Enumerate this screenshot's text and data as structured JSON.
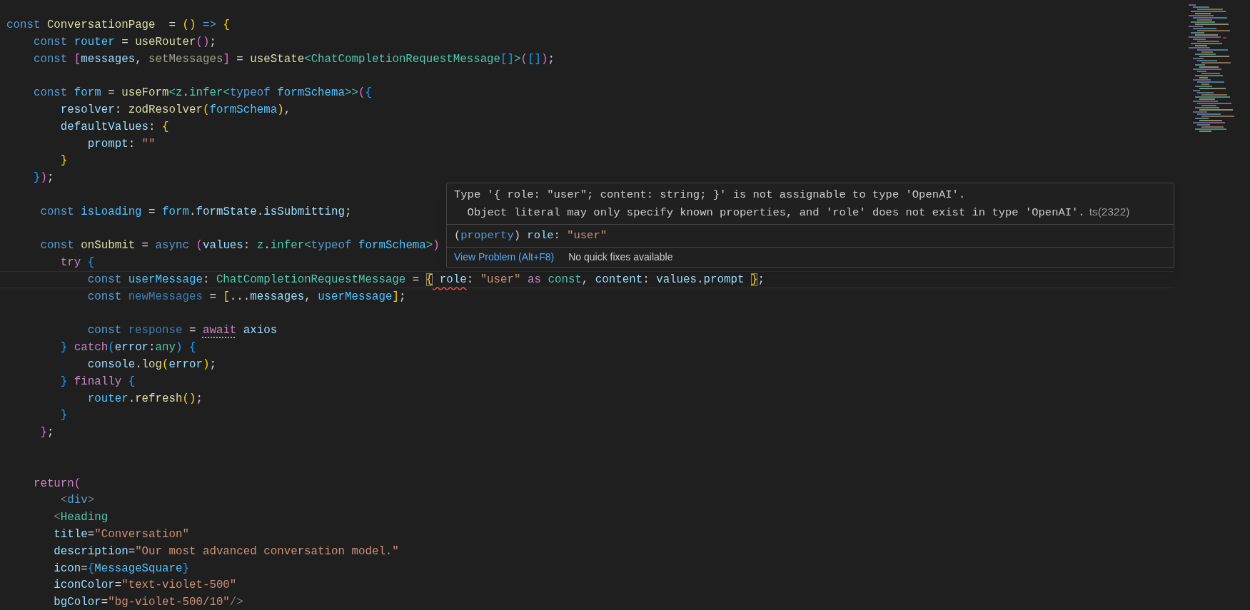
{
  "editor": {
    "lines": [
      {
        "kind": "code",
        "tokens": [
          {
            "text": "const ",
            "kind": "kw"
          },
          {
            "text": "ConversationPage",
            "kind": "fn"
          },
          {
            "text": "  = ",
            "kind": "p"
          },
          {
            "text": "() ",
            "kind": "b1"
          },
          {
            "text": "=> ",
            "kind": "kw"
          },
          {
            "text": "{",
            "kind": "b1"
          }
        ]
      },
      {
        "kind": "code",
        "tokens": [
          {
            "text": "    const ",
            "kind": "kw"
          },
          {
            "text": "router",
            "kind": "cvar"
          },
          {
            "text": " = ",
            "kind": "p"
          },
          {
            "text": "useRouter",
            "kind": "fn"
          },
          {
            "text": "()",
            "kind": "b2"
          },
          {
            "text": ";",
            "kind": "p"
          }
        ]
      },
      {
        "kind": "code",
        "tokens": [
          {
            "text": "    const ",
            "kind": "kw"
          },
          {
            "text": "[",
            "kind": "b2"
          },
          {
            "text": "messages",
            "kind": "var"
          },
          {
            "text": ", ",
            "kind": "p"
          },
          {
            "text": "setMessages",
            "kind": "unused_fn"
          },
          {
            "text": "]",
            "kind": "b2"
          },
          {
            "text": " = ",
            "kind": "p"
          },
          {
            "text": "useState",
            "kind": "fn"
          },
          {
            "text": "<",
            "kind": "type"
          },
          {
            "text": "ChatCompletionRequestMessage",
            "kind": "type"
          },
          {
            "text": "[]",
            "kind": "b3"
          },
          {
            "text": ">",
            "kind": "type"
          },
          {
            "text": "(",
            "kind": "b2"
          },
          {
            "text": "[]",
            "kind": "b3"
          },
          {
            "text": ")",
            "kind": "b2"
          },
          {
            "text": ";",
            "kind": "p"
          }
        ]
      },
      {
        "kind": "blank"
      },
      {
        "kind": "code",
        "tokens": [
          {
            "text": "    const ",
            "kind": "kw"
          },
          {
            "text": "form",
            "kind": "cvar"
          },
          {
            "text": " = ",
            "kind": "p"
          },
          {
            "text": "useForm",
            "kind": "fn"
          },
          {
            "text": "<",
            "kind": "type"
          },
          {
            "text": "z",
            "kind": "type"
          },
          {
            "text": ".",
            "kind": "p"
          },
          {
            "text": "infer",
            "kind": "type"
          },
          {
            "text": "<",
            "kind": "type"
          },
          {
            "text": "typeof ",
            "kind": "kw"
          },
          {
            "text": "formSchema",
            "kind": "cvar"
          },
          {
            "text": ">>",
            "kind": "type"
          },
          {
            "text": "(",
            "kind": "b2"
          },
          {
            "text": "{",
            "kind": "b3"
          }
        ]
      },
      {
        "kind": "code",
        "tokens": [
          {
            "text": "        resolver",
            "kind": "var"
          },
          {
            "text": ": ",
            "kind": "p"
          },
          {
            "text": "zodResolver",
            "kind": "fn"
          },
          {
            "text": "(",
            "kind": "b1"
          },
          {
            "text": "formSchema",
            "kind": "cvar"
          },
          {
            "text": ")",
            "kind": "b1"
          },
          {
            "text": ",",
            "kind": "p"
          }
        ]
      },
      {
        "kind": "code",
        "tokens": [
          {
            "text": "        defaultValues",
            "kind": "var"
          },
          {
            "text": ": ",
            "kind": "p"
          },
          {
            "text": "{",
            "kind": "b1"
          }
        ]
      },
      {
        "kind": "code",
        "tokens": [
          {
            "text": "            prompt",
            "kind": "var"
          },
          {
            "text": ": ",
            "kind": "p"
          },
          {
            "text": "\"\"",
            "kind": "str"
          }
        ]
      },
      {
        "kind": "code",
        "tokens": [
          {
            "text": "        }",
            "kind": "b1"
          }
        ]
      },
      {
        "kind": "code",
        "tokens": [
          {
            "text": "    }",
            "kind": "b3"
          },
          {
            "text": ")",
            "kind": "b2"
          },
          {
            "text": ";",
            "kind": "p"
          }
        ]
      },
      {
        "kind": "blank"
      },
      {
        "kind": "code",
        "tokens": [
          {
            "text": "     const ",
            "kind": "kw"
          },
          {
            "text": "isLoading",
            "kind": "cvar"
          },
          {
            "text": " = ",
            "kind": "p"
          },
          {
            "text": "form",
            "kind": "cvar"
          },
          {
            "text": ".",
            "kind": "p"
          },
          {
            "text": "formState",
            "kind": "var"
          },
          {
            "text": ".",
            "kind": "p"
          },
          {
            "text": "isSubmitting",
            "kind": "var"
          },
          {
            "text": ";",
            "kind": "p"
          }
        ]
      },
      {
        "kind": "blank"
      },
      {
        "kind": "code",
        "tokens": [
          {
            "text": "     const ",
            "kind": "kw"
          },
          {
            "text": "onSubmit",
            "kind": "fn"
          },
          {
            "text": " = ",
            "kind": "p"
          },
          {
            "text": "async ",
            "kind": "kw"
          },
          {
            "text": "(",
            "kind": "b2"
          },
          {
            "text": "values",
            "kind": "var"
          },
          {
            "text": ": ",
            "kind": "p"
          },
          {
            "text": "z",
            "kind": "type"
          },
          {
            "text": ".",
            "kind": "p"
          },
          {
            "text": "infer",
            "kind": "type"
          },
          {
            "text": "<",
            "kind": "type"
          },
          {
            "text": "typeof ",
            "kind": "kw"
          },
          {
            "text": "formSchema",
            "kind": "cvar"
          },
          {
            "text": ">",
            "kind": "type"
          },
          {
            "text": ")",
            "kind": "b2"
          }
        ]
      },
      {
        "kind": "code",
        "tokens": [
          {
            "text": "        try ",
            "kind": "ctrl"
          },
          {
            "text": "{",
            "kind": "b3"
          }
        ]
      },
      {
        "kind": "code",
        "current": true,
        "tokens": [
          {
            "text": "            const ",
            "kind": "kw"
          },
          {
            "text": "userMessage",
            "kind": "cvar"
          },
          {
            "text": ": ",
            "kind": "p"
          },
          {
            "text": "ChatCompletionRequestMessage",
            "kind": "type"
          },
          {
            "text": " = ",
            "kind": "p"
          },
          {
            "text": "{",
            "kind": "b1",
            "matched": true
          },
          {
            "text": " role",
            "kind": "var",
            "error": true
          },
          {
            "text": ": ",
            "kind": "p"
          },
          {
            "text": "\"user\"",
            "kind": "str"
          },
          {
            "text": " as ",
            "kind": "ctrl"
          },
          {
            "text": "const",
            "kind": "type"
          },
          {
            "text": ", ",
            "kind": "p"
          },
          {
            "text": "content",
            "kind": "var"
          },
          {
            "text": ": ",
            "kind": "p"
          },
          {
            "text": "values",
            "kind": "var"
          },
          {
            "text": ".",
            "kind": "p"
          },
          {
            "text": "prompt ",
            "kind": "var"
          },
          {
            "text": "}",
            "kind": "b1",
            "matched": true
          },
          {
            "text": ";",
            "kind": "p"
          }
        ]
      },
      {
        "kind": "code",
        "tokens": [
          {
            "text": "            const ",
            "kind": "kw"
          },
          {
            "text": "newMessages",
            "kind": "unused_var"
          },
          {
            "text": " = ",
            "kind": "p"
          },
          {
            "text": "[",
            "kind": "b1"
          },
          {
            "text": "...",
            "kind": "p"
          },
          {
            "text": "messages",
            "kind": "var"
          },
          {
            "text": ", ",
            "kind": "p"
          },
          {
            "text": "userMessage",
            "kind": "cvar"
          },
          {
            "text": "]",
            "kind": "b1"
          },
          {
            "text": ";",
            "kind": "p"
          }
        ]
      },
      {
        "kind": "blank"
      },
      {
        "kind": "code",
        "tokens": [
          {
            "text": "            const ",
            "kind": "kw"
          },
          {
            "text": "response",
            "kind": "unused_var"
          },
          {
            "text": " = ",
            "kind": "p"
          },
          {
            "text": "await",
            "kind": "ctrl",
            "hint": true
          },
          {
            "text": " axios",
            "kind": "var"
          }
        ]
      },
      {
        "kind": "code",
        "tokens": [
          {
            "text": "        } ",
            "kind": "b3"
          },
          {
            "text": "catch",
            "kind": "ctrl"
          },
          {
            "text": "(",
            "kind": "b3"
          },
          {
            "text": "error",
            "kind": "var"
          },
          {
            "text": ":",
            "kind": "p"
          },
          {
            "text": "any",
            "kind": "type"
          },
          {
            "text": ") ",
            "kind": "b3"
          },
          {
            "text": "{",
            "kind": "b3"
          }
        ]
      },
      {
        "kind": "code",
        "tokens": [
          {
            "text": "            console",
            "kind": "var"
          },
          {
            "text": ".",
            "kind": "p"
          },
          {
            "text": "log",
            "kind": "fn"
          },
          {
            "text": "(",
            "kind": "b1"
          },
          {
            "text": "error",
            "kind": "var"
          },
          {
            "text": ")",
            "kind": "b1"
          },
          {
            "text": ";",
            "kind": "p"
          }
        ]
      },
      {
        "kind": "code",
        "tokens": [
          {
            "text": "        } ",
            "kind": "b3"
          },
          {
            "text": "finally ",
            "kind": "ctrl"
          },
          {
            "text": "{",
            "kind": "b3"
          }
        ]
      },
      {
        "kind": "code",
        "tokens": [
          {
            "text": "            router",
            "kind": "cvar"
          },
          {
            "text": ".",
            "kind": "p"
          },
          {
            "text": "refresh",
            "kind": "fn"
          },
          {
            "text": "()",
            "kind": "b1"
          },
          {
            "text": ";",
            "kind": "p"
          }
        ]
      },
      {
        "kind": "code",
        "tokens": [
          {
            "text": "        }",
            "kind": "b3"
          }
        ]
      },
      {
        "kind": "code",
        "tokens": [
          {
            "text": "     }",
            "kind": "b2"
          },
          {
            "text": ";",
            "kind": "p"
          }
        ]
      },
      {
        "kind": "blank"
      },
      {
        "kind": "blank"
      },
      {
        "kind": "code",
        "tokens": [
          {
            "text": "    return",
            "kind": "ctrl"
          },
          {
            "text": "(",
            "kind": "b2"
          }
        ]
      },
      {
        "kind": "code",
        "tokens": [
          {
            "text": "        <",
            "kind": "tag"
          },
          {
            "text": "div",
            "kind": "kw"
          },
          {
            "text": ">",
            "kind": "tag"
          }
        ]
      },
      {
        "kind": "code",
        "tokens": [
          {
            "text": "       <",
            "kind": "tag"
          },
          {
            "text": "Heading",
            "kind": "type"
          }
        ]
      },
      {
        "kind": "code",
        "tokens": [
          {
            "text": "       title",
            "kind": "var"
          },
          {
            "text": "=",
            "kind": "p"
          },
          {
            "text": "\"Conversation\"",
            "kind": "str"
          }
        ]
      },
      {
        "kind": "code",
        "tokens": [
          {
            "text": "       description",
            "kind": "var"
          },
          {
            "text": "=",
            "kind": "p"
          },
          {
            "text": "\"Our most advanced conversation model.\"",
            "kind": "str"
          }
        ]
      },
      {
        "kind": "code",
        "tokens": [
          {
            "text": "       icon",
            "kind": "var"
          },
          {
            "text": "=",
            "kind": "p"
          },
          {
            "text": "{",
            "kind": "b3"
          },
          {
            "text": "MessageSquare",
            "kind": "cvar"
          },
          {
            "text": "}",
            "kind": "b3"
          }
        ]
      },
      {
        "kind": "code",
        "tokens": [
          {
            "text": "       iconColor",
            "kind": "var"
          },
          {
            "text": "=",
            "kind": "p"
          },
          {
            "text": "\"text-violet-500\"",
            "kind": "str"
          }
        ]
      },
      {
        "kind": "code",
        "tokens": [
          {
            "text": "       bgColor",
            "kind": "var"
          },
          {
            "text": "=",
            "kind": "p"
          },
          {
            "text": "\"bg-violet-500/10\"",
            "kind": "str"
          },
          {
            "text": "/>",
            "kind": "tag"
          }
        ]
      }
    ]
  },
  "hover": {
    "message_lines": [
      "Type '{ role: \"user\"; content: string; }' is not assignable to type 'OpenAI'.",
      "  Object literal may only specify known properties, and 'role' does not exist in type 'OpenAI'."
    ],
    "code": "ts(2322)",
    "signature": [
      {
        "text": "(",
        "kind": "p"
      },
      {
        "text": "property",
        "kind": "kw"
      },
      {
        "text": ") ",
        "kind": "p"
      },
      {
        "text": "role",
        "kind": "var"
      },
      {
        "text": ": ",
        "kind": "p"
      },
      {
        "text": "\"user\"",
        "kind": "str"
      }
    ],
    "link": "View Problem (Alt+F8)",
    "status": "No quick fixes available"
  }
}
